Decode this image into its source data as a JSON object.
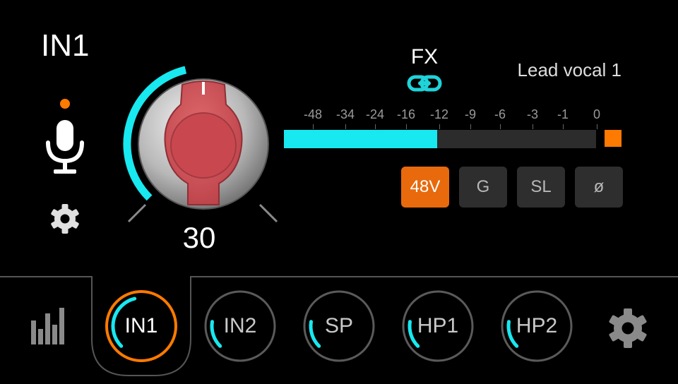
{
  "channel": {
    "title": "IN1",
    "status_color": "#ff7a00"
  },
  "gain": {
    "value": "30",
    "level": 0.45,
    "accent": "#18e8f0"
  },
  "fx": {
    "label": "FX",
    "link_color": "#1fd3d9"
  },
  "track": {
    "name": "Lead vocal 1"
  },
  "meter": {
    "ticks": [
      "-48",
      "-34",
      "-24",
      "-16",
      "-12",
      "-9",
      "-6",
      "-3",
      "-1",
      "0"
    ],
    "level_fraction": 0.49,
    "clip": true,
    "fill_color": "#18e8f0",
    "clip_color": "#ff7a00"
  },
  "buttons": [
    {
      "label": "48V",
      "active": true
    },
    {
      "label": "G",
      "active": false
    },
    {
      "label": "SL",
      "active": false
    },
    {
      "label": "ø",
      "active": false
    }
  ],
  "tabs": [
    {
      "label": "IN1",
      "active": true,
      "level": 0.45
    },
    {
      "label": "IN2",
      "active": false,
      "level": 0.2
    },
    {
      "label": "SP",
      "active": false,
      "level": 0.2
    },
    {
      "label": "HP1",
      "active": false,
      "level": 0.2
    },
    {
      "label": "HP2",
      "active": false,
      "level": 0.2
    }
  ],
  "icons": {
    "mic": "microphone-icon",
    "channel_settings": "gear-icon",
    "mixer": "mixer-bars-icon",
    "settings": "gear-icon",
    "fx_link": "link-icon"
  },
  "colors": {
    "active_tab": "#ff7a00",
    "accent": "#18e8f0",
    "inactive_ring": "#5a5a5a"
  }
}
